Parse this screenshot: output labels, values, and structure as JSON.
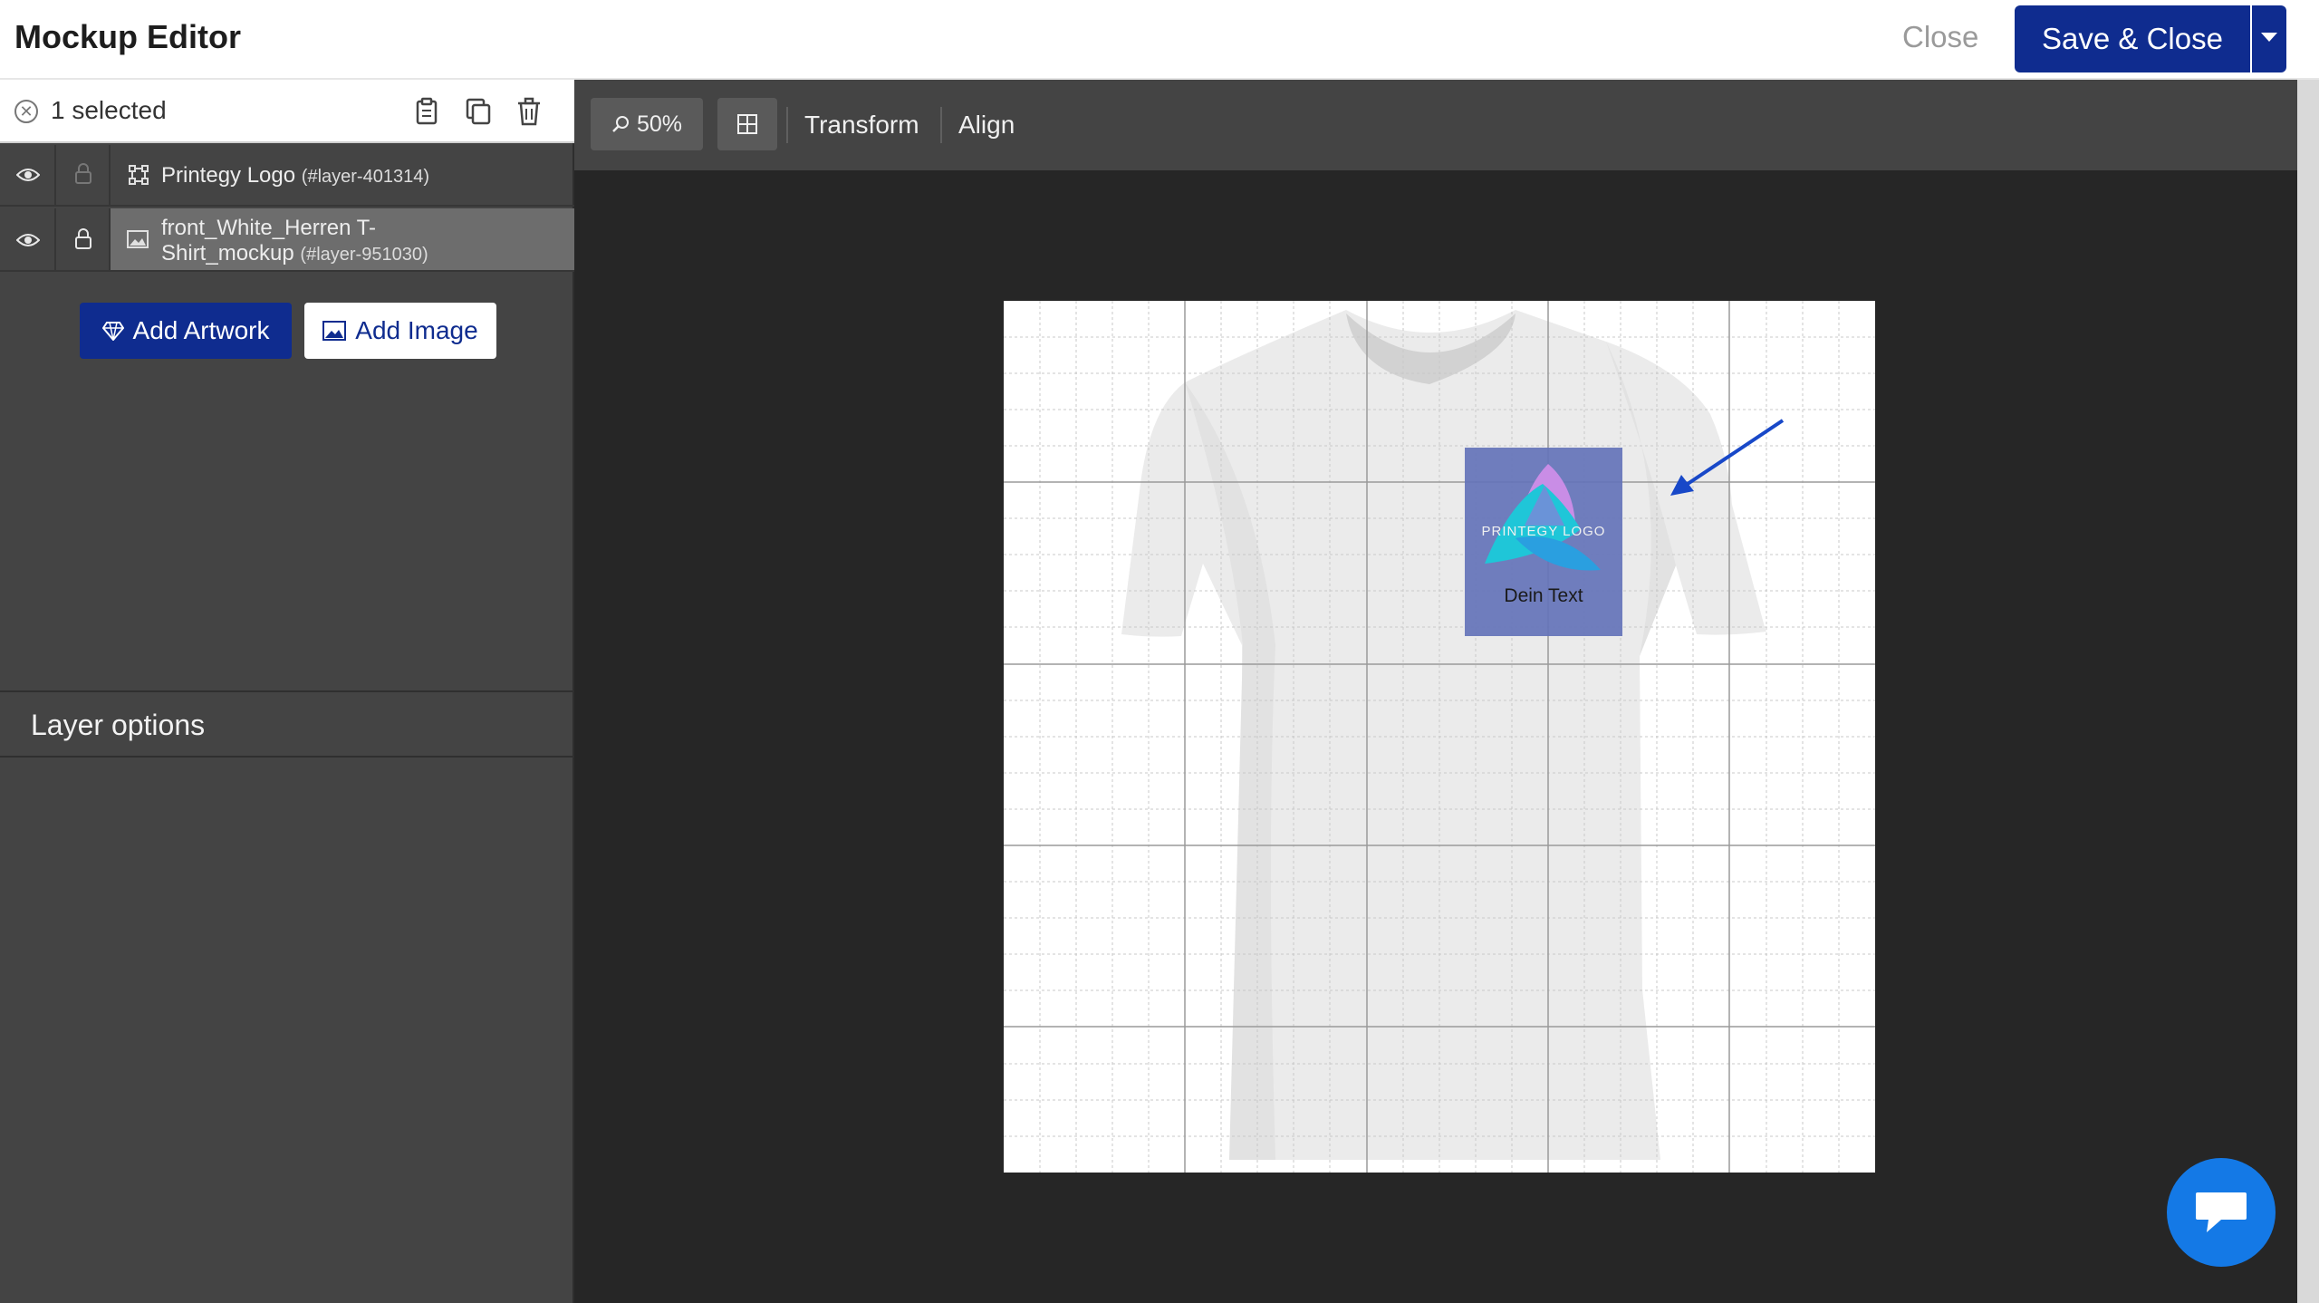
{
  "header": {
    "title": "Mockup Editor",
    "close_label": "Close",
    "save_label": "Save & Close"
  },
  "selection": {
    "text": "1 selected"
  },
  "layers": [
    {
      "name": "Printegy Logo",
      "id": "(#layer-401314)",
      "visible": true,
      "locked": false,
      "selected": false,
      "icon": "artwork-icon"
    },
    {
      "name_line1": "front_White_Herren T-",
      "name_line2": "Shirt_mockup",
      "id": "(#layer-951030)",
      "visible": true,
      "locked": true,
      "selected": true,
      "icon": "image-icon"
    }
  ],
  "buttons": {
    "add_artwork": "Add Artwork",
    "add_image": "Add Image"
  },
  "layer_options": {
    "title": "Layer options"
  },
  "toolbar": {
    "zoom": "50%",
    "transform": "Transform",
    "align": "Align"
  },
  "canvas": {
    "logo_text": "PRINTEGY LOGO",
    "dein_text": "Dein Text",
    "background": "#ffffff",
    "overlay_color": "#6473b9",
    "arrow_color": "#1848c8"
  },
  "colors": {
    "primary": "#0f2c8f",
    "panel": "#444444",
    "workspace": "#262626",
    "chat": "#1479e6"
  }
}
